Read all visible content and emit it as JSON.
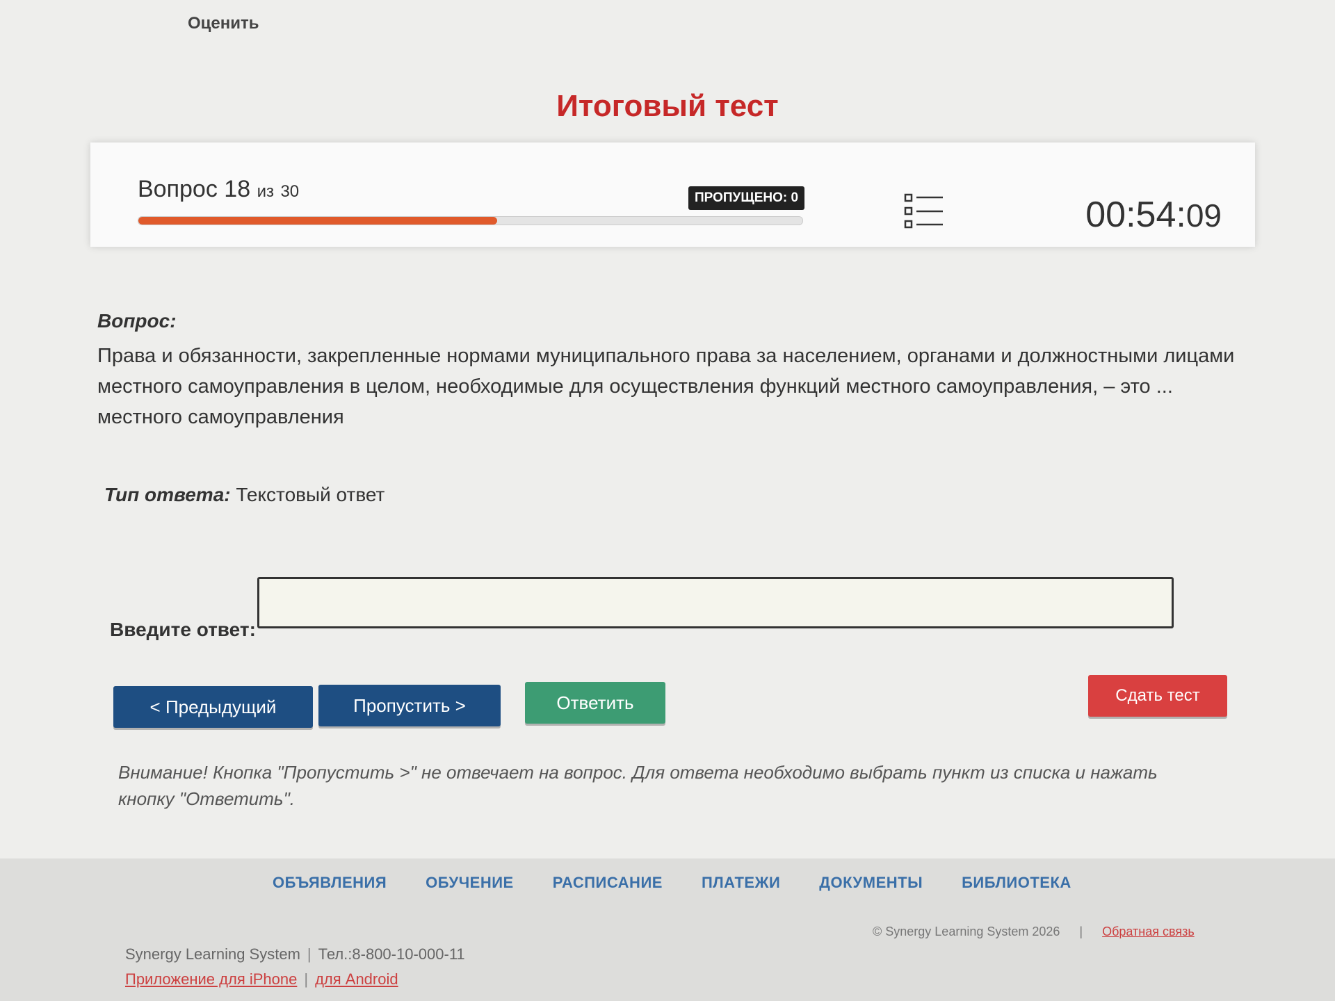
{
  "header": {
    "rate_label": "Оценить",
    "title": "Итоговый тест"
  },
  "status": {
    "question_word": "Вопрос",
    "question_number": "18",
    "of_label": "из",
    "total_questions": "30",
    "progress_fraction": 0.54,
    "skipped_badge": "ПРОПУЩЕНО: 0",
    "timer_main": "00:54:",
    "timer_seconds": "09"
  },
  "question": {
    "label": "Вопрос:",
    "text": "Права и обязанности, закрепленные нормами муниципального права за населением, органами и должностными лицами местного самоуправления в целом, необходимые для осуществления функций местного самоуправления, – это ... местного самоуправления",
    "answer_type_label": "Тип ответа:",
    "answer_type_value": "Текстовый ответ",
    "input_label": "Введите ответ:",
    "input_value": ""
  },
  "buttons": {
    "prev": "< Предыдущий",
    "skip": "Пропустить >",
    "answer": "Ответить",
    "submit": "Сдать тест"
  },
  "warning": "Внимание! Кнопка \"Пропустить >\" не отвечает на вопрос. Для ответа необходимо выбрать пункт из списка и нажать кнопку \"Ответить\".",
  "footer": {
    "nav": [
      "ОБЪЯВЛЕНИЯ",
      "ОБУЧЕНИЕ",
      "РАСПИСАНИЕ",
      "ПЛАТЕЖИ",
      "ДОКУМЕНТЫ",
      "БИБЛИОТЕКА"
    ],
    "brand": "Synergy Learning System",
    "phone": "Тел.:8-800-10-000-11",
    "iphone_link": "Приложение для iPhone",
    "android_link": "для Android",
    "copyright": "© Synergy Learning System 2026",
    "feedback_link": "Обратная связь"
  },
  "colors": {
    "title_red": "#c62828",
    "progress_orange": "#e05a2b",
    "primary_blue": "#1e4e82",
    "answer_green": "#3d9c73",
    "submit_red": "#d94040"
  }
}
